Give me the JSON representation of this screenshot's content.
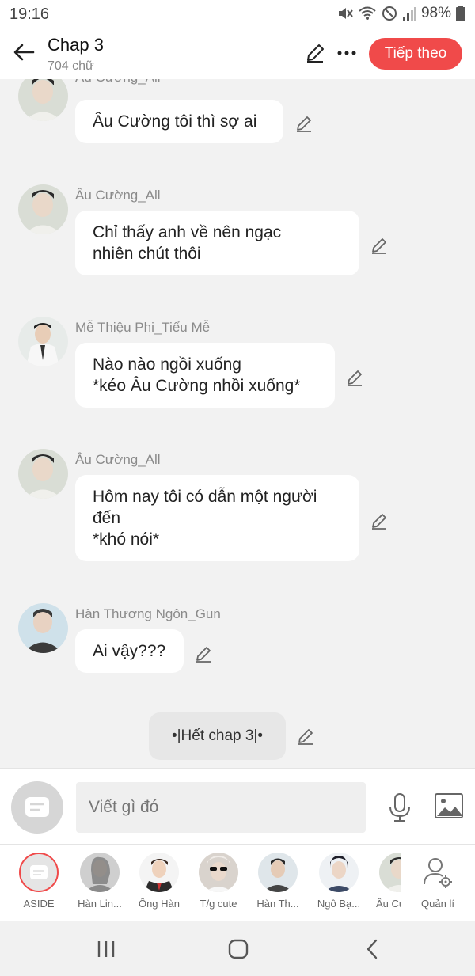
{
  "status_bar": {
    "time": "19:16",
    "battery": "98%"
  },
  "header": {
    "title": "Chap 3",
    "word_count": "704 chữ",
    "next_label": "Tiếp theo"
  },
  "messages": [
    {
      "sender": "Âu Cường_All",
      "text": "Âu Cường tôi thì sợ ai"
    },
    {
      "sender": "Âu Cường_All",
      "text": "Chỉ thấy anh về nên ngạc\nnhiên chút thôi"
    },
    {
      "sender": "Mễ Thiệu Phi_Tiểu Mễ",
      "text": "Nào nào ngồi xuống\n*kéo Âu Cường nhồi xuống*"
    },
    {
      "sender": "Âu Cường_All",
      "text": "Hôm nay tôi có dẫn một người\nđến\n*khó nói*"
    },
    {
      "sender": "Hàn Thương Ngôn_Gun",
      "text": "Ai vậy???"
    }
  ],
  "system_message": "•|Hết chap 3|•",
  "composer": {
    "placeholder": "Viết gì đó"
  },
  "characters": [
    {
      "name": "ASIDE"
    },
    {
      "name": "Hàn Lin..."
    },
    {
      "name": "Ông Hàn"
    },
    {
      "name": "T/g cute"
    },
    {
      "name": "Hàn Th..."
    },
    {
      "name": "Ngô Bạ..."
    },
    {
      "name": "Âu Cư"
    }
  ],
  "manage_label": "Quản lí",
  "colors": {
    "accent": "#f04a4a",
    "background": "#f2f2f2",
    "bubble": "#ffffff"
  }
}
